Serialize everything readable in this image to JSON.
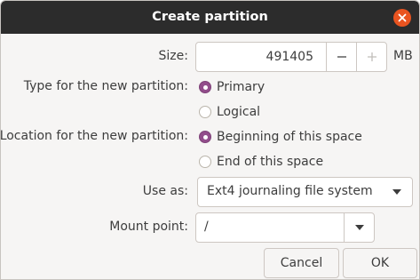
{
  "dialog": {
    "title": "Create partition"
  },
  "icons": {
    "close": "close-icon",
    "minus": "minus-icon",
    "plus": "plus-icon",
    "dropdown": "chevron-down-icon"
  },
  "colors": {
    "titlebar": "#2c2c2c",
    "close_button": "#e95420",
    "radio_selected": "#924d8b",
    "window_background": "#f6f5f4"
  },
  "size": {
    "label": "Size:",
    "value": "491405",
    "unit": "MB",
    "decrement_enabled": true,
    "increment_enabled": false
  },
  "partition_type": {
    "label": "Type for the new partition:",
    "options": [
      {
        "label": "Primary",
        "selected": true
      },
      {
        "label": "Logical",
        "selected": false
      }
    ]
  },
  "location": {
    "label": "Location for the new partition:",
    "options": [
      {
        "label": "Beginning of this space",
        "selected": true
      },
      {
        "label": "End of this space",
        "selected": false
      }
    ]
  },
  "use_as": {
    "label": "Use as:",
    "selected": "Ext4 journaling file system"
  },
  "mount_point": {
    "label": "Mount point:",
    "value": "/"
  },
  "buttons": {
    "cancel": "Cancel",
    "ok": "OK"
  }
}
